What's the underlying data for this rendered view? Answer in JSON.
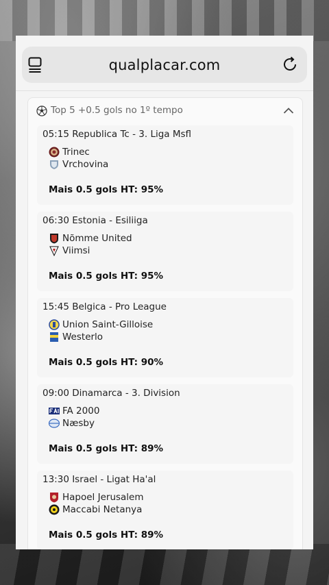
{
  "browser": {
    "url": "qualplacar.com"
  },
  "section": {
    "title": "Top 5 +0.5 gols no 1º tempo",
    "icon": "soccer-ball-icon"
  },
  "matches": [
    {
      "header": "05:15 Republica Tc - 3. Liga Msfl",
      "home": "Trinec",
      "away": "Vrchovina",
      "prediction": "Mais 0.5 gols HT: 95%"
    },
    {
      "header": "06:30 Estonia - Esiliiga",
      "home": "Nõmme United",
      "away": "Viimsi",
      "prediction": "Mais 0.5 gols HT: 95%"
    },
    {
      "header": "15:45 Belgica - Pro League",
      "home": "Union Saint-Gilloise",
      "away": "Westerlo",
      "prediction": "Mais 0.5 gols HT: 90%"
    },
    {
      "header": "09:00 Dinamarca - 3. Division",
      "home": "FA 2000",
      "away": "Næsby",
      "prediction": "Mais 0.5 gols HT: 89%"
    },
    {
      "header": "13:30 Israel - Ligat Ha'al",
      "home": "Hapoel Jerusalem",
      "away": "Maccabi Netanya",
      "prediction": "Mais 0.5 gols HT: 89%"
    }
  ]
}
